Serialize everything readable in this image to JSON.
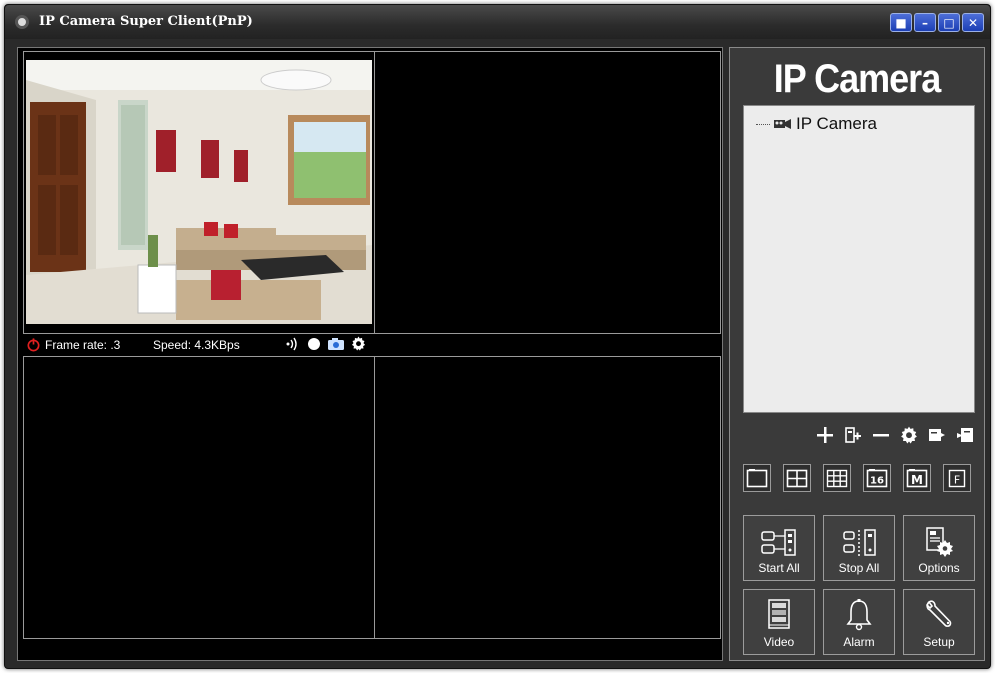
{
  "window": {
    "title": "IP Camera Super Client(PnP)"
  },
  "title_buttons": [
    "■",
    "–",
    "□",
    "✕"
  ],
  "video": {
    "status": {
      "frame_rate_label": "Frame rate: .3",
      "speed_label": "Speed: 4.3KBps"
    }
  },
  "sidebar": {
    "brand": "IP Camera",
    "tree": {
      "items": [
        {
          "label": "IP Camera",
          "icon": "camera-icon"
        }
      ]
    },
    "tools": [
      "add-icon",
      "edit-icon",
      "remove-icon",
      "settings-icon",
      "export-icon",
      "import-icon"
    ],
    "layouts": [
      {
        "name": "layout-1"
      },
      {
        "name": "layout-4"
      },
      {
        "name": "layout-9"
      },
      {
        "name": "layout-16",
        "text": "16"
      },
      {
        "name": "layout-M",
        "text": "M"
      },
      {
        "name": "layout-F",
        "text": "F"
      }
    ],
    "buttons": {
      "start_all": "Start All",
      "stop_all": "Stop All",
      "options": "Options",
      "video": "Video",
      "alarm": "Alarm",
      "setup": "Setup"
    }
  },
  "colors": {
    "panel_bg": "#3a3a3a",
    "title_btn_blue": "#2a4fc4",
    "tree_bg": "#ececec",
    "status_red": "#e02020"
  }
}
